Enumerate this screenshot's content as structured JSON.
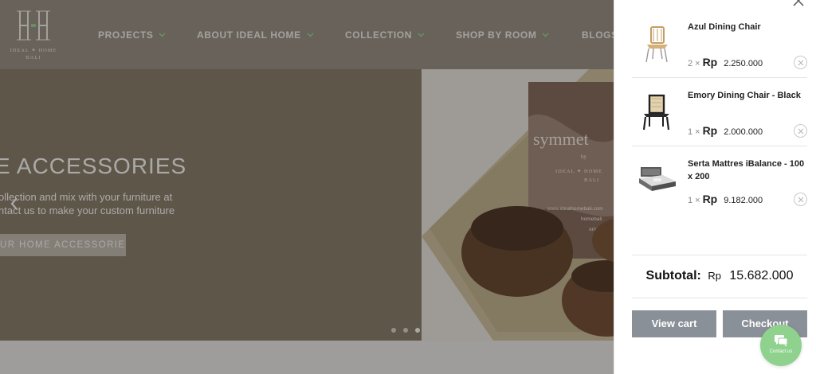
{
  "header": {
    "logo_text_line1": "IDEAL ✦ HOME",
    "logo_text_line2": "BALI",
    "nav": [
      {
        "label": "PROJECTS"
      },
      {
        "label": "ABOUT IDEAL HOME"
      },
      {
        "label": "COLLECTION"
      },
      {
        "label": "SHOP BY ROOM"
      },
      {
        "label": "BLOGS"
      }
    ],
    "chevron_color": "#8ed28e"
  },
  "hero": {
    "title": "E ACCESSORIES",
    "subtitle_line1": "ollection and mix with your furniture at",
    "subtitle_line2": "ntact us to make your custom furniture",
    "button_label": "UR HOME ACCESSORIES",
    "slide_count": 3,
    "active_slide": 3,
    "image_text": {
      "brand_word": "symmet",
      "by": "by",
      "brand_line1": "IDEAL ✦ HOME",
      "brand_line2": "BALI",
      "web_line1": "www.idealhomebali.com",
      "web_line2": "homebali",
      "web_line3": "om/ideali"
    }
  },
  "cart": {
    "items": [
      {
        "name": "Azul Dining Chair",
        "qty": "2",
        "currency": "Rp",
        "price": "2.250.000",
        "icon": "chair-icon"
      },
      {
        "name": "Emory Dining Chair - Black",
        "qty": "1",
        "currency": "Rp",
        "price": "2.000.000",
        "icon": "chair-icon"
      },
      {
        "name": "Serta Mattres iBalance - 100 x 200",
        "qty": "1",
        "currency": "Rp",
        "price": "9.182.000",
        "icon": "bed-icon"
      }
    ],
    "multiply_sign": "×",
    "subtotal_label": "Subtotal:",
    "subtotal_currency": "Rp",
    "subtotal_amount": "15.682.000",
    "view_cart_label": "View cart",
    "checkout_label": "Checkout"
  },
  "contact": {
    "label": "Contact us",
    "color": "#8ed28e"
  },
  "colors": {
    "header_bg": "#8f897f",
    "hero_bg": "#7f7563",
    "button_gray": "#8a9097",
    "accent_green": "#8ed28e"
  }
}
